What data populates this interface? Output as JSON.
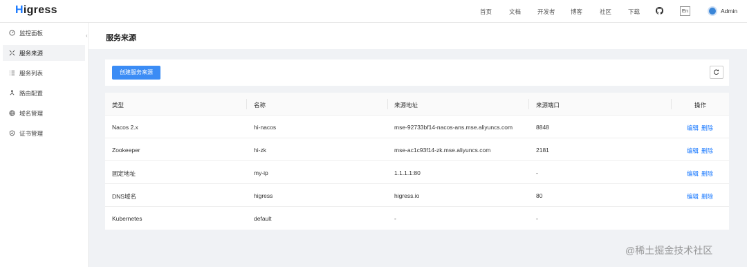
{
  "header": {
    "logo": "Higress",
    "logo_first": "H",
    "logo_rest": "igress",
    "nav": [
      "首页",
      "文档",
      "开发者",
      "博客",
      "社区",
      "下载"
    ],
    "lang": "En",
    "user": "Admin"
  },
  "sidebar": {
    "items": [
      {
        "label": "监控面板",
        "icon": "dashboard-icon"
      },
      {
        "label": "服务来源",
        "icon": "service-source-icon"
      },
      {
        "label": "服务列表",
        "icon": "list-icon"
      },
      {
        "label": "路由配置",
        "icon": "route-icon"
      },
      {
        "label": "域名管理",
        "icon": "globe-icon"
      },
      {
        "label": "证书管理",
        "icon": "shield-icon"
      }
    ],
    "active_index": 1
  },
  "page": {
    "title": "服务来源",
    "create_button": "创建服务来源"
  },
  "table": {
    "columns": [
      "类型",
      "名称",
      "来源地址",
      "来源端口",
      "操作"
    ],
    "rows": [
      {
        "type": "Nacos 2.x",
        "name": "hi-nacos",
        "address": "mse-92733bf14-nacos-ans.mse.aliyuncs.com",
        "port": "8848",
        "edit": "编辑",
        "delete": "删除"
      },
      {
        "type": "Zookeeper",
        "name": "hi-zk",
        "address": "mse-ac1c93f14-zk.mse.aliyuncs.com",
        "port": "2181",
        "edit": "编辑",
        "delete": "删除"
      },
      {
        "type": "固定地址",
        "name": "my-ip",
        "address": "1.1.1.1:80",
        "port": "-",
        "edit": "编辑",
        "delete": "删除"
      },
      {
        "type": "DNS域名",
        "name": "higress",
        "address": "higress.io",
        "port": "80",
        "edit": "编辑",
        "delete": "删除"
      },
      {
        "type": "Kubernetes",
        "name": "default",
        "address": "-",
        "port": "-",
        "edit": "",
        "delete": ""
      }
    ]
  },
  "watermark": "@稀土掘金技术社区",
  "colors": {
    "primary": "#1677ff",
    "button": "#3b8cf5",
    "bg": "#f0f2f5"
  }
}
